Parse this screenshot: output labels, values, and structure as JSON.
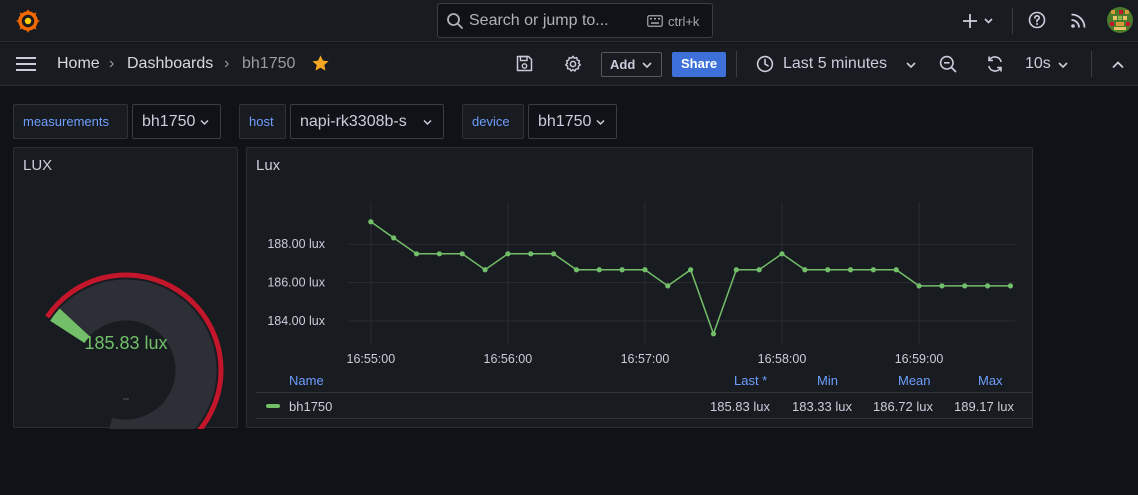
{
  "topbar": {
    "search_placeholder": "Search or jump to...",
    "search_shortcut": "ctrl+k"
  },
  "nav": {
    "breadcrumbs": [
      "Home",
      "Dashboards",
      "bh1750"
    ],
    "add_label": "Add",
    "share_label": "Share",
    "time_range": "Last 5 minutes",
    "refresh_interval": "10s"
  },
  "variables": [
    {
      "label": "measurements",
      "value": "bh1750"
    },
    {
      "label": "host",
      "value": "napi-rk3308b-s"
    },
    {
      "label": "device",
      "value": "bh1750"
    }
  ],
  "gauge_panel": {
    "title": "LUX",
    "value_text": "185.83 lux",
    "value": 185.83,
    "min": 0,
    "max": 190,
    "threshold_color": "#c4162a",
    "value_color": "#73bf69"
  },
  "timeseries_panel": {
    "title": "Lux",
    "legend": {
      "headers": {
        "name": "Name",
        "last": "Last *",
        "min": "Min",
        "mean": "Mean",
        "max": "Max"
      },
      "rows": [
        {
          "name": "bh1750",
          "last": "185.83 lux",
          "min": "183.33 lux",
          "mean": "186.72 lux",
          "max": "189.17 lux"
        }
      ]
    }
  },
  "chart_data": {
    "type": "line",
    "title": "Lux",
    "xlabel": "",
    "ylabel": "",
    "x_ticks": [
      "16:55:00",
      "16:56:00",
      "16:57:00",
      "16:58:00",
      "16:59:00"
    ],
    "y_ticks": [
      "184.00 lux",
      "186.00 lux",
      "188.00 lux"
    ],
    "ylim": [
      182.8,
      190.2
    ],
    "xlim_seconds": [
      -10,
      270
    ],
    "grid": true,
    "series": [
      {
        "name": "bh1750",
        "color": "#73bf69",
        "x_seconds": [
          0,
          10,
          20,
          30,
          40,
          50,
          60,
          70,
          80,
          90,
          100,
          110,
          120,
          130,
          140,
          150,
          160,
          170,
          180,
          190,
          200,
          210,
          220,
          230,
          240,
          250,
          260,
          270,
          280
        ],
        "values": [
          189.17,
          188.33,
          187.5,
          187.5,
          187.5,
          186.67,
          187.5,
          187.5,
          187.5,
          186.67,
          186.67,
          186.67,
          186.67,
          185.83,
          186.67,
          183.33,
          186.67,
          186.67,
          187.5,
          186.67,
          186.67,
          186.67,
          186.67,
          186.67,
          185.83,
          185.83,
          185.83,
          185.83,
          185.83
        ]
      }
    ]
  }
}
